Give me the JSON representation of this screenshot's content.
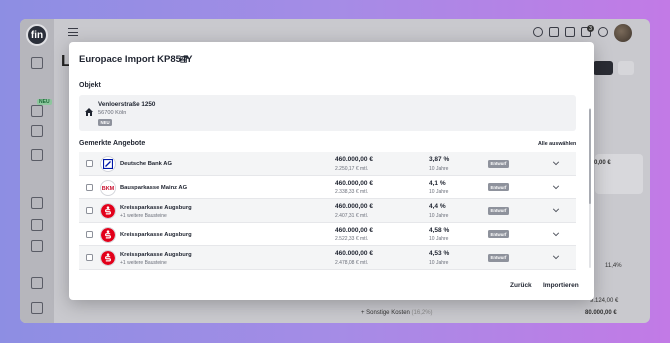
{
  "background_app": {
    "logo_text": "fin",
    "sidebar_badge": "NEU",
    "page_title_partial": "L",
    "notification_count": "3",
    "right_panel": {
      "value_top": "0,00 €",
      "percent": "11,4%",
      "line1_amount": "9.124,00 €",
      "line2_label": "Sonstige Kosten",
      "line2_percent": "(16,2%)",
      "line2_amount": "80.000,00 €"
    }
  },
  "modal": {
    "title": "Europace Import KP854Y",
    "objekt_label": "Objekt",
    "objekt": {
      "street": "Venloerstraße 1250",
      "city": "56700 Köln",
      "badge": "NEU"
    },
    "offers_label": "Gemerkte Angebote",
    "select_all": "Alle auswählen",
    "offers": [
      {
        "bank": "Deutsche Bank AG",
        "sub": "",
        "amount": "460.000,00 €",
        "monthly": "2.250,17 € mtl.",
        "rate": "3,87 %",
        "term": "10 Jahre",
        "status": "Entwurf",
        "logo": "deutsche-bank"
      },
      {
        "bank": "Bausparkasse Mainz AG",
        "sub": "",
        "amount": "460.000,00 €",
        "monthly": "2.338,33 € mtl.",
        "rate": "4,1 %",
        "term": "10 Jahre",
        "status": "Entwurf",
        "logo": "bkm"
      },
      {
        "bank": "Kreissparkasse Augsburg",
        "sub": "+1 weitere Bausteine",
        "amount": "460.000,00 €",
        "monthly": "2.407,31 € mtl.",
        "rate": "4,4 %",
        "term": "10 Jahre",
        "status": "Entwurf",
        "logo": "sparkasse"
      },
      {
        "bank": "Kreissparkasse Augsburg",
        "sub": "",
        "amount": "460.000,00 €",
        "monthly": "2.522,33 € mtl.",
        "rate": "4,58 %",
        "term": "10 Jahre",
        "status": "Entwurf",
        "logo": "sparkasse"
      },
      {
        "bank": "Kreissparkasse Augsburg",
        "sub": "+1 weitere Bausteine",
        "amount": "460.000,00 €",
        "monthly": "2.478,08 € mtl.",
        "rate": "4,53 %",
        "term": "10 Jahre",
        "status": "Entwurf",
        "logo": "sparkasse"
      }
    ],
    "back_label": "Zurück",
    "import_label": "Importieren"
  },
  "colors": {
    "sparkasse_red": "#e2001a",
    "deutsche_bank_blue": "#0018a8",
    "status_grey": "#8e929c"
  }
}
